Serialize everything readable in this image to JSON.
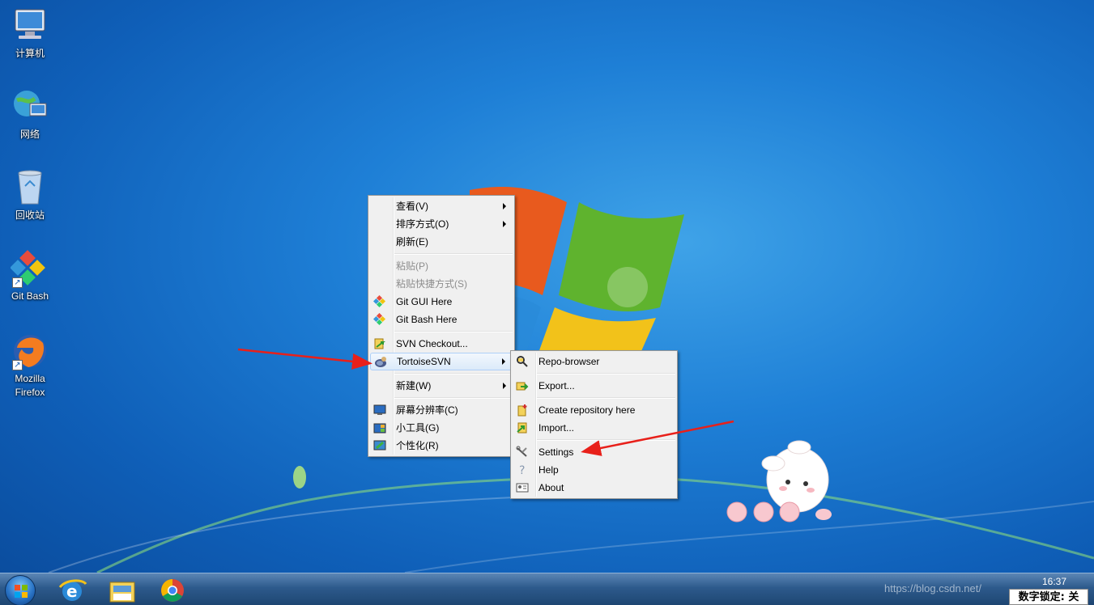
{
  "desktop_icons": [
    {
      "label": "计算机",
      "icon": "computer-icon"
    },
    {
      "label": "网络",
      "icon": "network-icon"
    },
    {
      "label": "回收站",
      "icon": "recycle-bin-icon"
    },
    {
      "label": "Git Bash",
      "icon": "git-bash-icon"
    },
    {
      "label": "Mozilla\nFirefox",
      "icon": "firefox-icon"
    }
  ],
  "context_menu": {
    "view": "查看(V)",
    "sort": "排序方式(O)",
    "refresh": "刷新(E)",
    "paste": "粘贴(P)",
    "paste_shortcut": "粘贴快捷方式(S)",
    "git_gui": "Git GUI Here",
    "git_bash": "Git Bash Here",
    "svn_checkout": "SVN Checkout...",
    "tortoise": "TortoiseSVN",
    "new": "新建(W)",
    "resolution": "屏幕分辨率(C)",
    "gadgets": "小工具(G)",
    "personalize": "个性化(R)"
  },
  "submenu": {
    "repo_browser": "Repo-browser",
    "export": "Export...",
    "create_repo": "Create repository here",
    "import": "Import...",
    "settings": "Settings",
    "help": "Help",
    "about": "About"
  },
  "taskbar": {
    "apps": [
      "internet-explorer-icon",
      "file-explorer-icon",
      "chrome-icon"
    ],
    "clock": "16:37",
    "watermark": "https://blog.csdn.net/",
    "numlock": "数字锁定: 关"
  },
  "colors": {
    "annotation_arrow": "#e8201a",
    "menu_bg": "#f0f0f0",
    "highlight_border": "#aecff7"
  }
}
